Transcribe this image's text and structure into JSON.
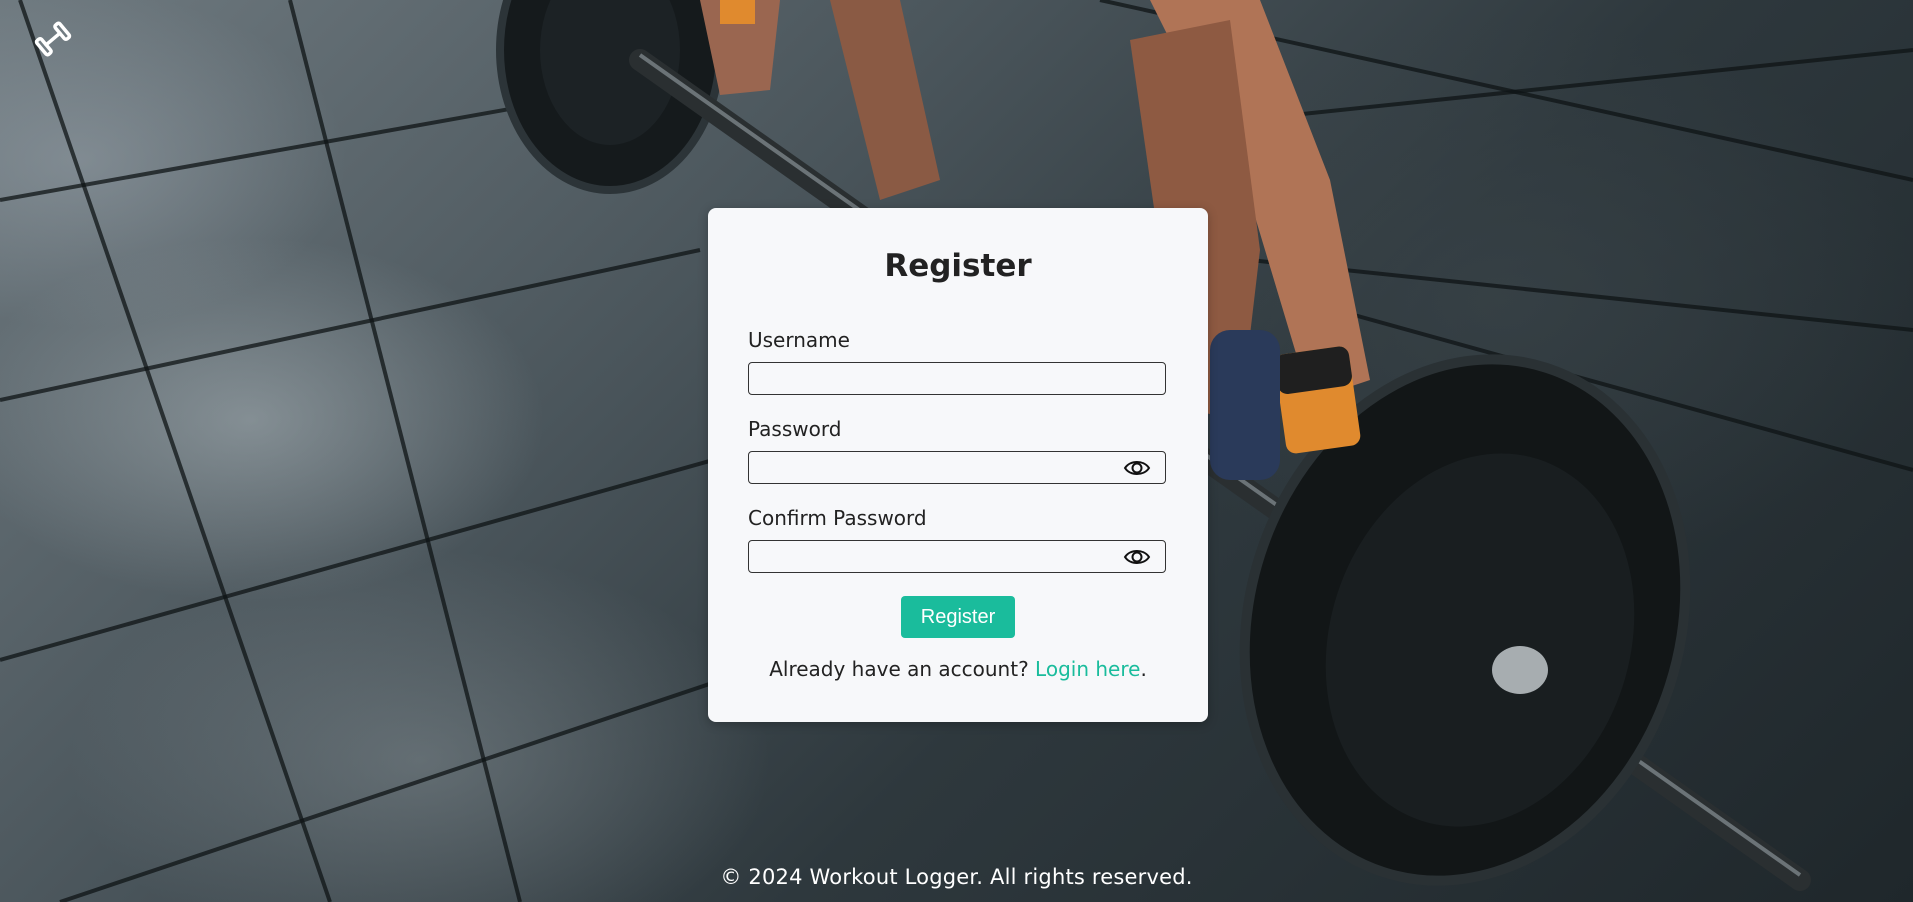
{
  "brand": {
    "logo_icon": "dumbbell-icon"
  },
  "form": {
    "title": "Register",
    "username_label": "Username",
    "username_value": "",
    "password_label": "Password",
    "password_value": "",
    "confirm_label": "Confirm Password",
    "confirm_value": "",
    "toggle_icon": "eye-icon",
    "submit_label": "Register",
    "login_prompt": "Already have an account? ",
    "login_link": "Login here",
    "login_suffix": "."
  },
  "footer": {
    "text": "© 2024 Workout Logger. All rights reserved."
  },
  "colors": {
    "accent": "#1abc9c",
    "card_bg": "#f7f8fa",
    "text": "#222222"
  }
}
